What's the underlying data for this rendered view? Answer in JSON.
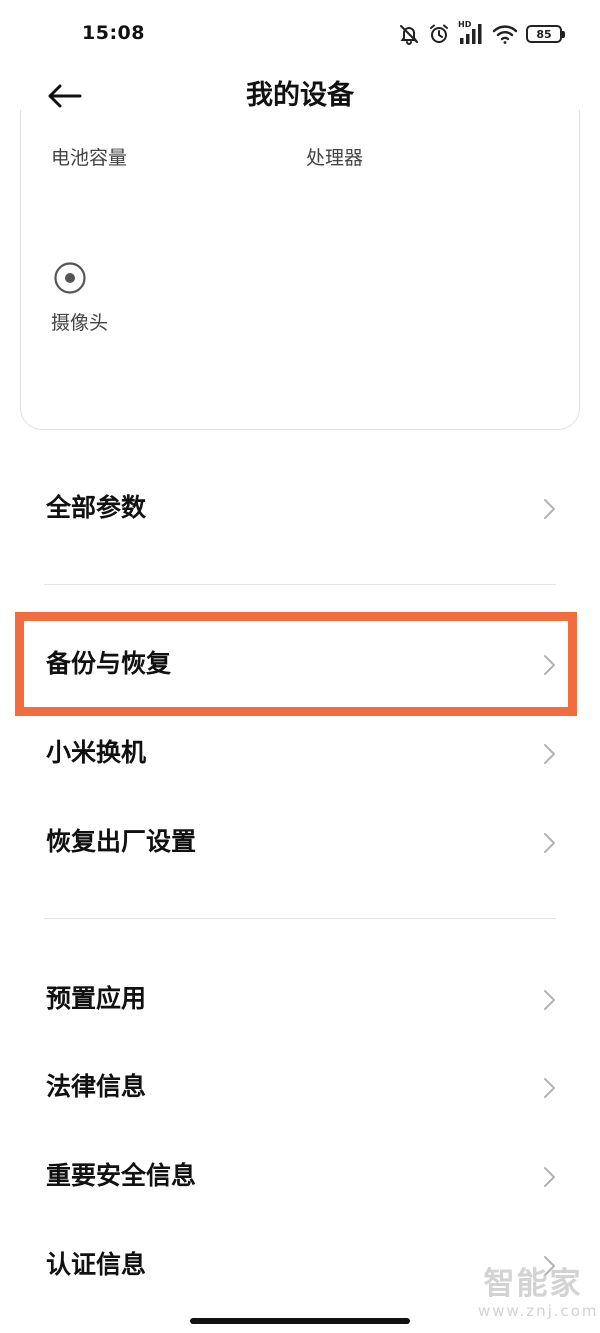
{
  "status_bar": {
    "time": "15:08",
    "network_badge": "HD",
    "battery_level": "85",
    "icons": [
      "bell-muted-icon",
      "alarm-icon",
      "signal-icon",
      "wifi-icon",
      "battery-icon"
    ]
  },
  "header": {
    "title": "我的设备",
    "back_icon": "arrow-left-icon"
  },
  "spec_card": {
    "battery_label": "电池容量",
    "processor_label": "处理器",
    "camera_label": "摄像头",
    "camera_icon": "camera-lens-icon"
  },
  "settings_groups": [
    {
      "items": [
        {
          "label": "全部参数"
        }
      ]
    },
    {
      "items": [
        {
          "label": "备份与恢复",
          "highlighted": true
        },
        {
          "label": "小米换机"
        },
        {
          "label": "恢复出厂设置"
        }
      ]
    },
    {
      "items": [
        {
          "label": "预置应用"
        },
        {
          "label": "法律信息"
        },
        {
          "label": "重要安全信息"
        },
        {
          "label": "认证信息"
        }
      ]
    }
  ],
  "watermark": {
    "text": "智能家",
    "url": "www.znj.com"
  },
  "colors": {
    "highlight": "#f26d3d",
    "divider": "#e4e4e4",
    "text_primary": "#111111",
    "text_secondary": "#444444"
  }
}
